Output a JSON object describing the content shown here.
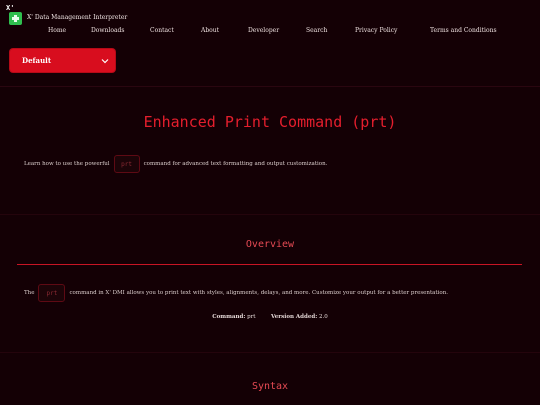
{
  "header": {
    "logo_text": "X'",
    "brand_title": "X' Data Management Interpreter"
  },
  "nav": {
    "items": [
      "Home",
      "Downloads",
      "Contact",
      "About",
      "Developer",
      "Search",
      "Privacy Policy",
      "Terms and Conditions"
    ]
  },
  "theme_select": {
    "value": "Default",
    "icon": "chevron-down-icon"
  },
  "hero": {
    "title": "Enhanced Print Command (prt)",
    "intro_before": "Learn how to use the powerful",
    "intro_code": "prt",
    "intro_after": "command for advanced text formatting and output customization."
  },
  "overview": {
    "title": "Overview",
    "text_before": "The",
    "code": "prt",
    "text_after": "command in X' DMI allows you to print text with styles, alignments, delays, and more. Customize your output for a better presentation.",
    "command_label": "Command:",
    "command_value": "prt",
    "version_label": "Version Added:",
    "version_value": "2.0"
  },
  "syntax": {
    "title": "Syntax"
  },
  "colors": {
    "background": "#140005",
    "accent": "#e51e2d",
    "select_bg": "#d80d1e",
    "logo_green": "#2fbf4f"
  }
}
